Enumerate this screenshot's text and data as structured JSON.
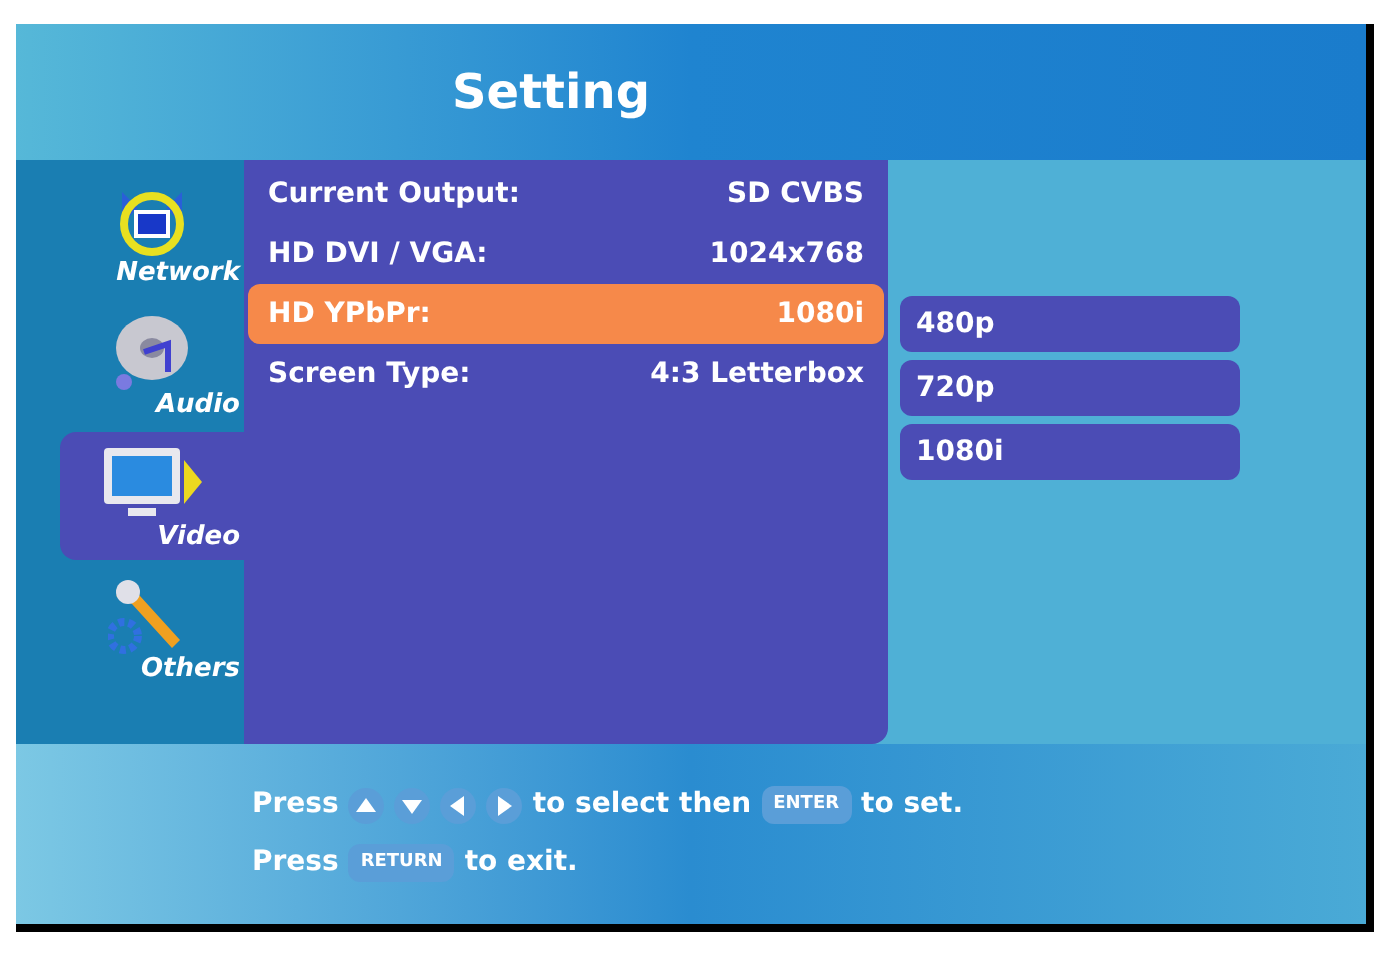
{
  "title": "Setting",
  "sidebar": [
    {
      "kind": "network",
      "label": "Network",
      "selected": false
    },
    {
      "kind": "audio",
      "label": "Audio",
      "selected": false
    },
    {
      "kind": "video",
      "label": "Video",
      "selected": true
    },
    {
      "kind": "others",
      "label": "Others",
      "selected": false
    }
  ],
  "settings": [
    {
      "label": "Current Output:",
      "value": "SD CVBS",
      "selected": false
    },
    {
      "label": "HD DVI / VGA:",
      "value": "1024x768",
      "selected": false
    },
    {
      "label": "HD YPbPr:",
      "value": "1080i",
      "selected": true
    },
    {
      "label": "Screen Type:",
      "value": "4:3 Letterbox",
      "selected": false
    }
  ],
  "options": [
    "480p",
    "720p",
    "1080i"
  ],
  "hints": [
    [
      {
        "kind": "text",
        "text": "Press"
      },
      {
        "kind": "up"
      },
      {
        "kind": "down"
      },
      {
        "kind": "left"
      },
      {
        "kind": "right"
      },
      {
        "kind": "text",
        "text": "to select then"
      },
      {
        "kind": "key",
        "text": "ENTER"
      },
      {
        "kind": "text",
        "text": "to set."
      }
    ],
    [
      {
        "kind": "text",
        "text": "Press"
      },
      {
        "kind": "key",
        "text": "RETURN"
      },
      {
        "kind": "text",
        "text": "to exit."
      }
    ]
  ]
}
